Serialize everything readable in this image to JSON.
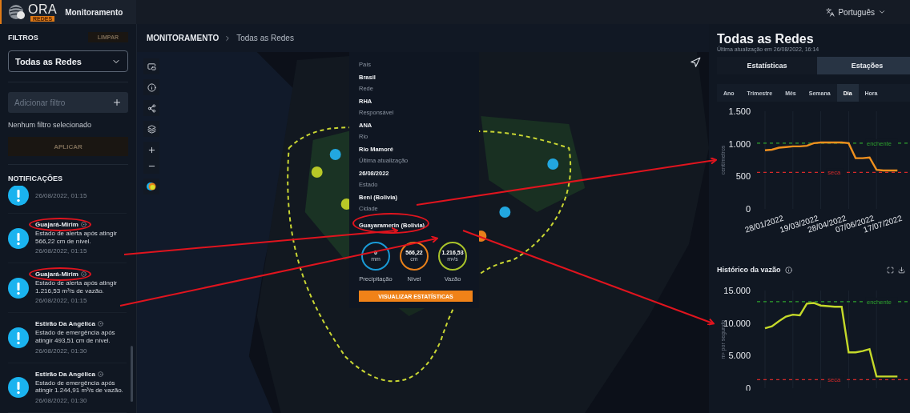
{
  "app": {
    "logo": "ORA",
    "logo_badge": "REDES",
    "section": "Monitoramento"
  },
  "language": {
    "label": "Português"
  },
  "filters": {
    "title": "FILTROS",
    "clear_button": "LIMPAR",
    "network_select": "Todas as Redes",
    "add_filter": {
      "placeholder": "Adicionar filtro"
    },
    "empty_message": "Nenhum filtro selecionado",
    "apply_button": "APLICAR"
  },
  "notifications": {
    "title": "NOTIFICAÇÕES",
    "items": [
      {
        "time": "26/08/2022, 01:15"
      },
      {
        "title": "Guajará-Mirim",
        "circled": true,
        "message": "Estado de alerta após atingir 566,22 cm de nível.",
        "time": "26/08/2022, 01:15"
      },
      {
        "title": "Guajará-Mirim",
        "circled": true,
        "message": "Estado de alerta após atingir 1.216,53 m³/s de vazão.",
        "time": "26/08/2022, 01:15"
      },
      {
        "title": "Estirão Da Angélica",
        "circled": false,
        "message": "Estado de emergência após atingir 493,51 cm de nível.",
        "time": "26/08/2022, 01:30"
      },
      {
        "title": "Estirão Da Angélica",
        "circled": false,
        "message": "Estado de emergência após atingir 1.244,91 m³/s de vazão.",
        "time": "26/08/2022, 01:30"
      }
    ]
  },
  "breadcrumb": {
    "root": "MONITORAMENTO",
    "current": "Todas as Redes"
  },
  "station_popup": {
    "fields": [
      {
        "label": "País",
        "value": "Brasil",
        "circled": false
      },
      {
        "label": "Rede",
        "value": "RHA",
        "circled": false
      },
      {
        "label": "Responsável",
        "value": "ANA",
        "circled": false
      },
      {
        "label": "Rio",
        "value": "Rio Mamoré",
        "circled": false
      },
      {
        "label": "Última atualização",
        "value": "26/08/2022",
        "circled": false
      },
      {
        "label": "Estado",
        "value": "Beni (Bolivia)",
        "circled": false
      },
      {
        "label": "Cidade",
        "value": "Guayaramerin (Bolivia)",
        "circled": true
      }
    ],
    "readings": [
      {
        "value": "0",
        "unit": "mm",
        "label": "Precipitação",
        "color": "#1a9ad6"
      },
      {
        "value": "566,22",
        "unit": "cm",
        "label": "Nível",
        "color": "#e8801a"
      },
      {
        "value": "1.216,53",
        "unit": "m³/s",
        "label": "Vazão",
        "color": "#a8c22a"
      }
    ],
    "button": "VISUALIZAR ESTATÍSTICAS"
  },
  "right_panel": {
    "title": "Todas as Redes",
    "updated": "Última atualização em 26/08/2022, 16:14",
    "tabs": [
      {
        "label": "Estatísticas",
        "selected": false
      },
      {
        "label": "Estações",
        "selected": true
      }
    ],
    "periods": [
      {
        "label": "Ano",
        "selected": false
      },
      {
        "label": "Trimestre",
        "selected": false
      },
      {
        "label": "Mês",
        "selected": false
      },
      {
        "label": "Semana",
        "selected": false
      },
      {
        "label": "Dia",
        "selected": true
      },
      {
        "label": "Hora",
        "selected": false
      }
    ],
    "level_chart": {
      "chart_data": {
        "type": "line",
        "ylabel": "centímetros",
        "ylim": [
          0,
          1500
        ],
        "yticks": [
          {
            "value": 0,
            "label": "0"
          },
          {
            "value": 500,
            "label": "500"
          },
          {
            "value": 1000,
            "label": "1.000"
          },
          {
            "value": 1500,
            "label": "1.500"
          }
        ],
        "categories": [
          "28/01/2022",
          null,
          null,
          null,
          null,
          "19/03/2022",
          null,
          null,
          null,
          "28/04/2022",
          null,
          null,
          null,
          "07/06/2022",
          null,
          null,
          null,
          "17/07/2022",
          null,
          null
        ],
        "series": [
          {
            "color": "#f0901e",
            "values": [
              900,
              910,
              940,
              950,
              960,
              960,
              970,
              1010,
              1020,
              1020,
              1020,
              1020,
              1010,
              780,
              780,
              790,
              600,
              590,
              590,
              590
            ]
          }
        ],
        "grid": true,
        "ref_lines": [
          {
            "axis": "y",
            "value": 1010,
            "label": "enchente",
            "color": "#2ea32e"
          },
          {
            "axis": "y",
            "value": 560,
            "label": "seca",
            "color": "#d62a2a"
          }
        ]
      }
    },
    "flow_chart": {
      "title": "Histórico da vazão",
      "chart_data": {
        "type": "line",
        "ylabel": "m³ por segundo",
        "ylim": [
          0,
          15000
        ],
        "yticks": [
          {
            "value": 0,
            "label": "0"
          },
          {
            "value": 5000,
            "label": "5.000"
          },
          {
            "value": 10000,
            "label": "10.000"
          },
          {
            "value": 15000,
            "label": "15.000"
          }
        ],
        "series": [
          {
            "color": "#c5d92a",
            "values": [
              9200,
              9500,
              10300,
              11000,
              11300,
              11200,
              13000,
              13100,
              12700,
              12600,
              12500,
              12500,
              5500,
              5500,
              5700,
              6000,
              1800,
              1800,
              1800,
              1800
            ]
          }
        ],
        "grid": true,
        "ref_lines": [
          {
            "axis": "y",
            "value": 13300,
            "label": "enchente",
            "color": "#2ea32e"
          },
          {
            "axis": "y",
            "value": 1300,
            "label": "seca",
            "color": "#d62a2a"
          }
        ]
      }
    }
  }
}
